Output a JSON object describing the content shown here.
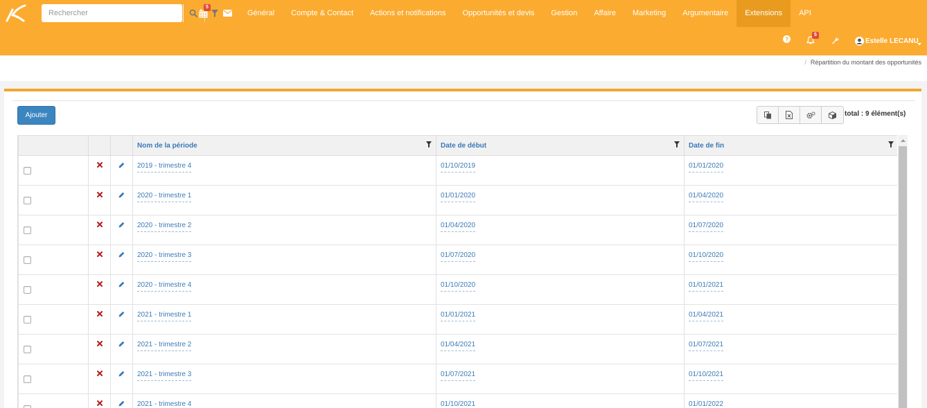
{
  "topbar": {
    "search": {
      "placeholder": "Rechercher"
    },
    "calendar_badge": "5",
    "menu": [
      {
        "label": "Général",
        "active": false
      },
      {
        "label": "Compte & Contact",
        "active": false
      },
      {
        "label": "Actions et notifications",
        "active": false
      },
      {
        "label": "Opportunités et devis",
        "active": false
      },
      {
        "label": "Gestion",
        "active": false
      },
      {
        "label": "Affaire",
        "active": false
      },
      {
        "label": "Marketing",
        "active": false
      },
      {
        "label": "Argumentaire",
        "active": false
      },
      {
        "label": "Extensions",
        "active": true
      },
      {
        "label": "API",
        "active": false
      }
    ],
    "notifications_badge": "5",
    "user_name": "Estelle LECANU",
    "colors": {
      "bar": "#fbab2f",
      "active": "#e89b1f",
      "badge": "#e04a3a"
    }
  },
  "breadcrumb": {
    "current": "Répartition du montant des opportunités"
  },
  "toolbar": {
    "add_label": "Ajouter",
    "total_label": "total : 9 élément(s)",
    "tool_icons": [
      "copy-icon",
      "excel-icon",
      "settings-icon",
      "box-icon"
    ]
  },
  "table": {
    "columns": [
      "Nom de la période",
      "Date de début",
      "Date de fin"
    ],
    "rows": [
      {
        "name": "2019 - trimestre 4",
        "start": "01/10/2019",
        "end": "01/01/2020"
      },
      {
        "name": "2020 - trimestre 1",
        "start": "01/01/2020",
        "end": "01/04/2020"
      },
      {
        "name": "2020 - trimestre 2",
        "start": "01/04/2020",
        "end": "01/07/2020"
      },
      {
        "name": "2020 - trimestre 3",
        "start": "01/07/2020",
        "end": "01/10/2020"
      },
      {
        "name": "2020 - trimestre 4",
        "start": "01/10/2020",
        "end": "01/01/2021"
      },
      {
        "name": "2021 - trimestre 1",
        "start": "01/01/2021",
        "end": "01/04/2021"
      },
      {
        "name": "2021 - trimestre 2",
        "start": "01/04/2021",
        "end": "01/07/2021"
      },
      {
        "name": "2021 - trimestre 3",
        "start": "01/07/2021",
        "end": "01/10/2021"
      },
      {
        "name": "2021 - trimestre 4",
        "start": "01/10/2021",
        "end": "01/01/2022"
      }
    ]
  }
}
